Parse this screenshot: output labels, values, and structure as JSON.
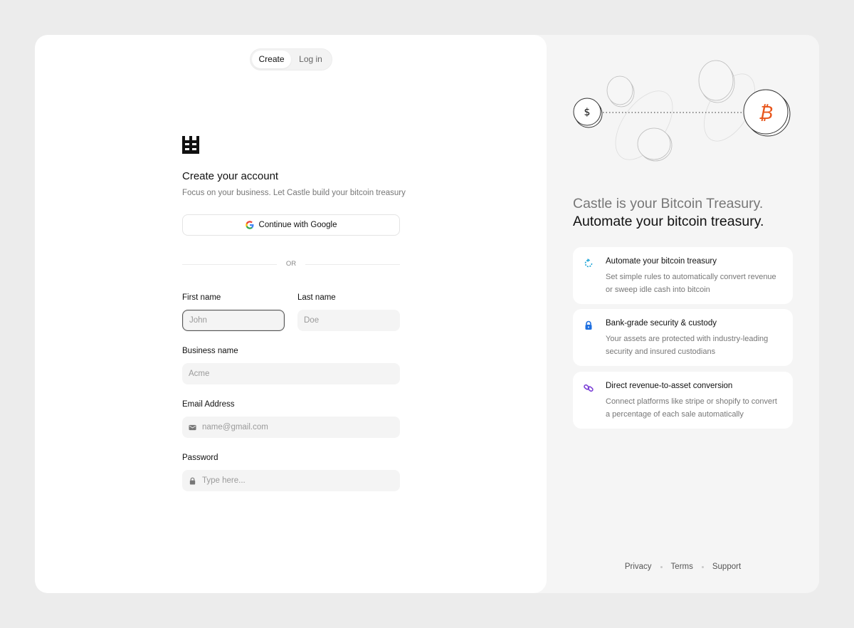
{
  "tabs": {
    "create": "Create",
    "login": "Log in"
  },
  "form": {
    "title": "Create your account",
    "subtitle": "Focus on your business. Let Castle build your bitcoin treasury",
    "google_button": "Continue with Google",
    "divider": "OR",
    "first_name_label": "First name",
    "first_name_placeholder": "John",
    "last_name_label": "Last name",
    "last_name_placeholder": "Doe",
    "business_label": "Business name",
    "business_placeholder": "Acme",
    "email_label": "Email Address",
    "email_placeholder": "name@gmail.com",
    "password_label": "Password",
    "password_placeholder": "Type here..."
  },
  "hero": {
    "line1": "Castle is your Bitcoin Treasury.",
    "line2": "Automate your bitcoin treasury."
  },
  "features": [
    {
      "icon": "refresh-icon",
      "title": "Automate your bitcoin treasury",
      "description": "Set simple rules to automatically convert revenue or sweep idle cash into bitcoin"
    },
    {
      "icon": "lock-icon",
      "title": "Bank-grade security & custody",
      "description": "Your assets are protected with industry-leading security and insured custodians"
    },
    {
      "icon": "link-icon",
      "title": "Direct revenue-to-asset conversion",
      "description": "Connect platforms like stripe or shopify to convert a percentage of each sale automatically"
    }
  ],
  "footer": {
    "privacy": "Privacy",
    "terms": "Terms",
    "support": "Support"
  },
  "colors": {
    "bitcoin_orange": "#e8561c",
    "refresh_blue": "#1aa3d6",
    "lock_blue": "#1e6fe0",
    "link_purple": "#7b3fd6"
  }
}
